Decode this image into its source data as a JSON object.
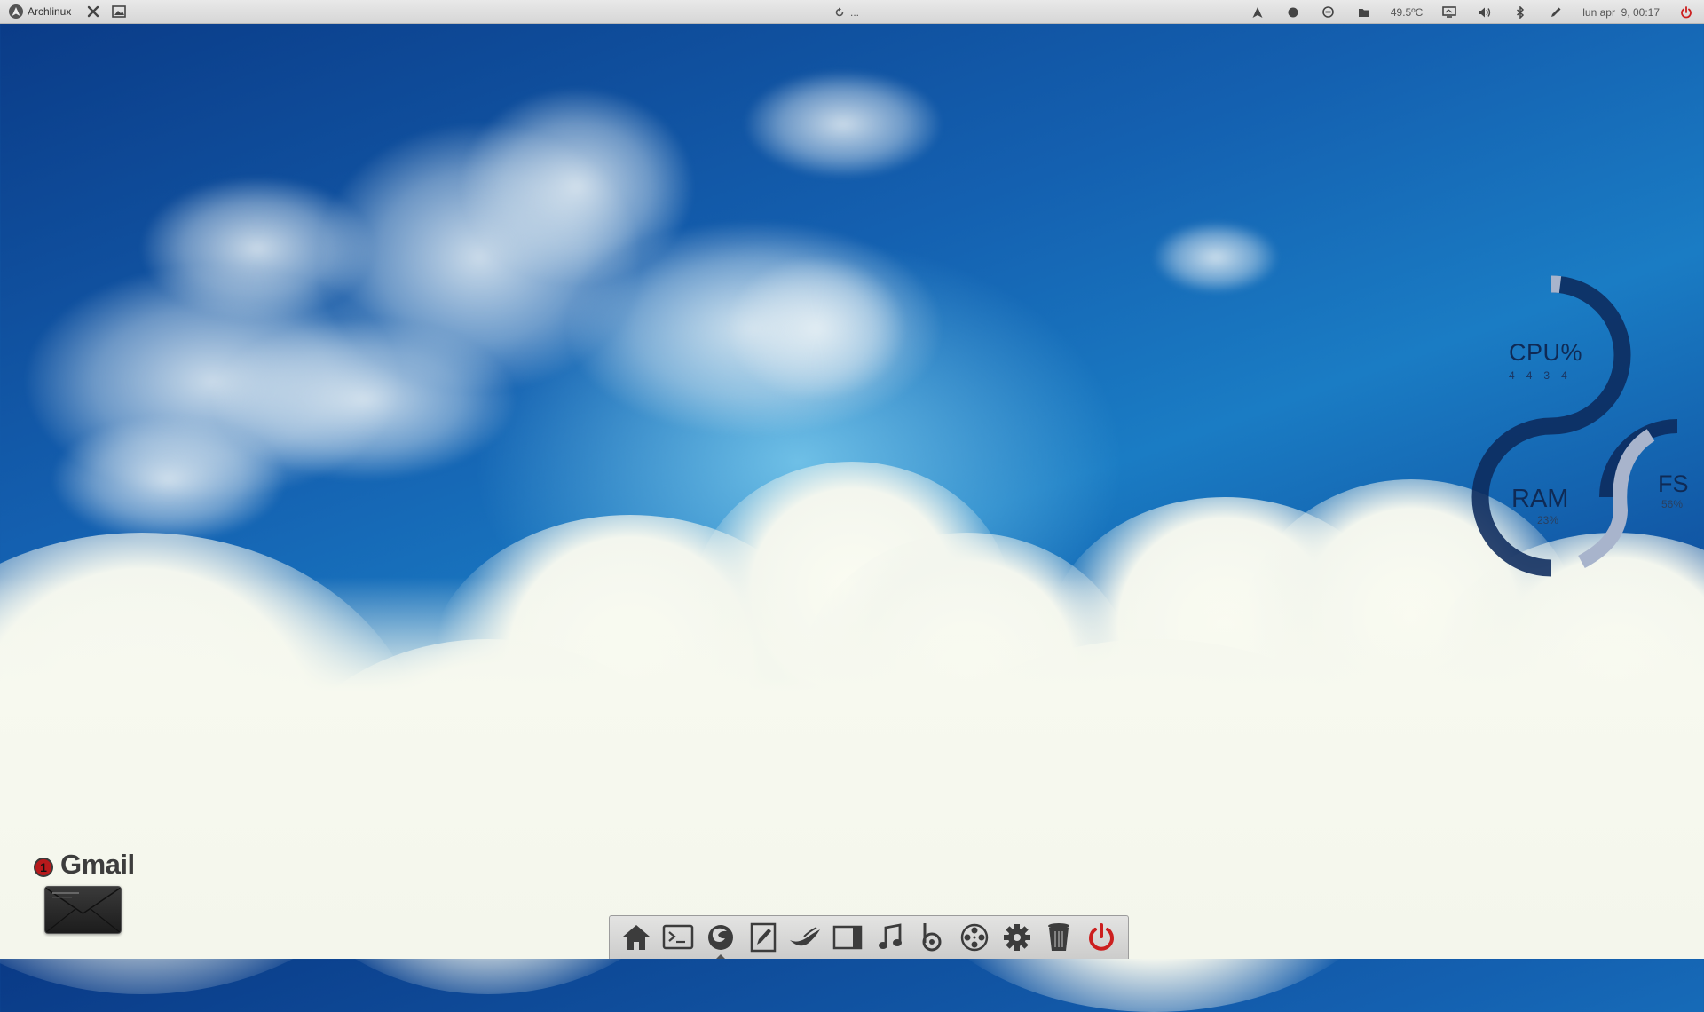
{
  "top_panel": {
    "app_menu_label": "Archlinux",
    "center_label": "...",
    "temperature": "49.5ºC",
    "clock": "lun apr  9, 00:17"
  },
  "conky": {
    "cpu_label": "CPU%",
    "cpu_cores": [
      "4",
      "4",
      "3",
      "4"
    ],
    "ram_label": "RAM",
    "ram_value": "23%",
    "fs_label": "FS",
    "fs_value": "56%"
  },
  "gmail": {
    "unread_count": "1",
    "label": "Gmail"
  },
  "dock": {
    "items": [
      {
        "name": "home-icon"
      },
      {
        "name": "terminal-icon"
      },
      {
        "name": "firefox-icon"
      },
      {
        "name": "text-editor-icon"
      },
      {
        "name": "thunderbird-icon"
      },
      {
        "name": "file-manager-icon"
      },
      {
        "name": "music-icon"
      },
      {
        "name": "bittorrent-icon"
      },
      {
        "name": "video-player-icon"
      },
      {
        "name": "settings-icon"
      },
      {
        "name": "trash-icon"
      },
      {
        "name": "power-icon"
      }
    ]
  },
  "colors": {
    "panel_bg": "#dcdcdc",
    "power_red": "#cc1f1f",
    "conky_dark": "#0d2450",
    "conky_light": "#a8b4cc"
  }
}
